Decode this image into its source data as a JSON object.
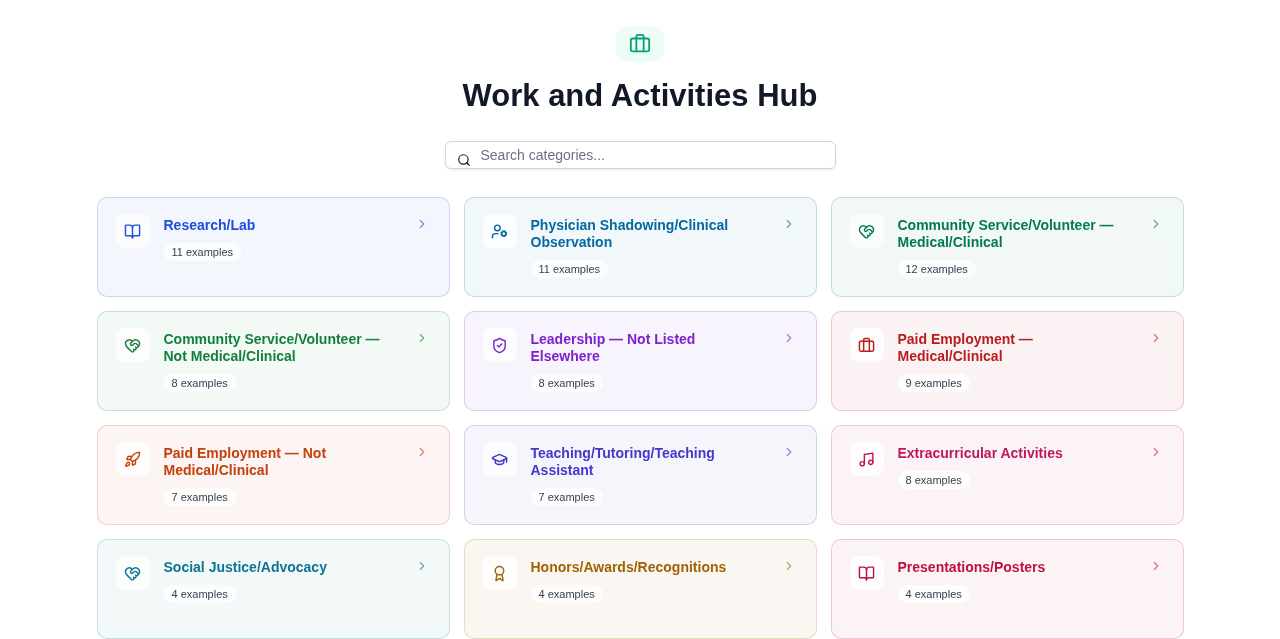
{
  "header": {
    "title": "Work and Activities Hub"
  },
  "search": {
    "placeholder": "Search categories..."
  },
  "categories": [
    {
      "title": "Research/Lab",
      "count": "11 examples",
      "color": "#1d4ed8"
    },
    {
      "title": "Physician Shadowing/Clinical Observation",
      "count": "11 examples",
      "color": "#0369a1"
    },
    {
      "title": "Community Service/Volunteer — Medical/Clinical",
      "count": "12 examples",
      "color": "#047857"
    },
    {
      "title": "Community Service/Volunteer — Not Medical/Clinical",
      "count": "8 examples",
      "color": "#15803d"
    },
    {
      "title": "Leadership — Not Listed Elsewhere",
      "count": "8 examples",
      "color": "#7e22ce"
    },
    {
      "title": "Paid Employment — Medical/Clinical",
      "count": "9 examples",
      "color": "#b91c1c"
    },
    {
      "title": "Paid Employment — Not Medical/Clinical",
      "count": "7 examples",
      "color": "#c2410c"
    },
    {
      "title": "Teaching/Tutoring/Teaching Assistant",
      "count": "7 examples",
      "color": "#4338ca"
    },
    {
      "title": "Extracurricular Activities",
      "count": "8 examples",
      "color": "#be185d"
    },
    {
      "title": "Social Justice/Advocacy",
      "count": "4 examples",
      "color": "#0e7490"
    },
    {
      "title": "Honors/Awards/Recognitions",
      "count": "4 examples",
      "color": "#a16207"
    },
    {
      "title": "Presentations/Posters",
      "count": "4 examples",
      "color": "#be123c"
    }
  ]
}
